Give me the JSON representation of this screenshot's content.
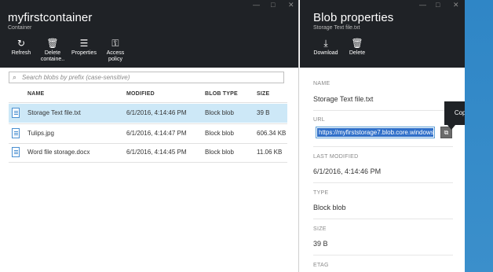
{
  "left_blade": {
    "title": "myfirstcontainer",
    "subtitle": "Container",
    "window_controls": [
      "—",
      "□",
      "✕"
    ],
    "toolbar": [
      {
        "icon": "refresh-icon",
        "glyph": "↻",
        "label": "Refresh"
      },
      {
        "icon": "trash-icon",
        "glyph": "🗑",
        "label_line1": "Delete",
        "label_line2": "containe.."
      },
      {
        "icon": "properties-icon",
        "glyph": "☰",
        "label": "Properties"
      },
      {
        "icon": "key-icon",
        "glyph": "⚿",
        "label_line1": "Access",
        "label_line2": "policy"
      }
    ],
    "search": {
      "placeholder": "Search blobs by prefix (case-sensitive)",
      "icon": "search-icon"
    },
    "table": {
      "columns": [
        "NAME",
        "MODIFIED",
        "BLOB TYPE",
        "SIZE"
      ],
      "rows": [
        {
          "name": "Storage Text file.txt",
          "modified": "6/1/2016, 4:14:46 PM",
          "type": "Block blob",
          "size": "39 B",
          "selected": true
        },
        {
          "name": "Tulips.jpg",
          "modified": "6/1/2016, 4:14:47 PM",
          "type": "Block blob",
          "size": "606.34 KB",
          "selected": false
        },
        {
          "name": "Word file storage.docx",
          "modified": "6/1/2016, 4:14:45 PM",
          "type": "Block blob",
          "size": "11.06 KB",
          "selected": false
        }
      ]
    }
  },
  "right_blade": {
    "title": "Blob properties",
    "subtitle": "Storage Text file.txt",
    "window_controls": [
      "—",
      "□",
      "✕"
    ],
    "toolbar": [
      {
        "icon": "download-icon",
        "glyph": "⤓",
        "label": "Download"
      },
      {
        "icon": "trash-icon",
        "glyph": "🗑",
        "label": "Delete"
      }
    ],
    "properties": {
      "name_label": "NAME",
      "name_value": "Storage Text file.txt",
      "url_label": "URL",
      "url_value": "https://myfirststorage7.blob.core.windows",
      "last_modified_label": "LAST MODIFIED",
      "last_modified_value": "6/1/2016, 4:14:46 PM",
      "type_label": "TYPE",
      "type_value": "Block blob",
      "size_label": "SIZE",
      "size_value": "39 B",
      "etag_label": "ETAG"
    },
    "copy_icon": "copy-icon",
    "tooltip": "Copied"
  },
  "colors": {
    "header_bg": "#1f2226",
    "selected_row": "#cde8f7",
    "selection_highlight": "#2f6fc9",
    "edge_blue": "#2f86c6"
  }
}
